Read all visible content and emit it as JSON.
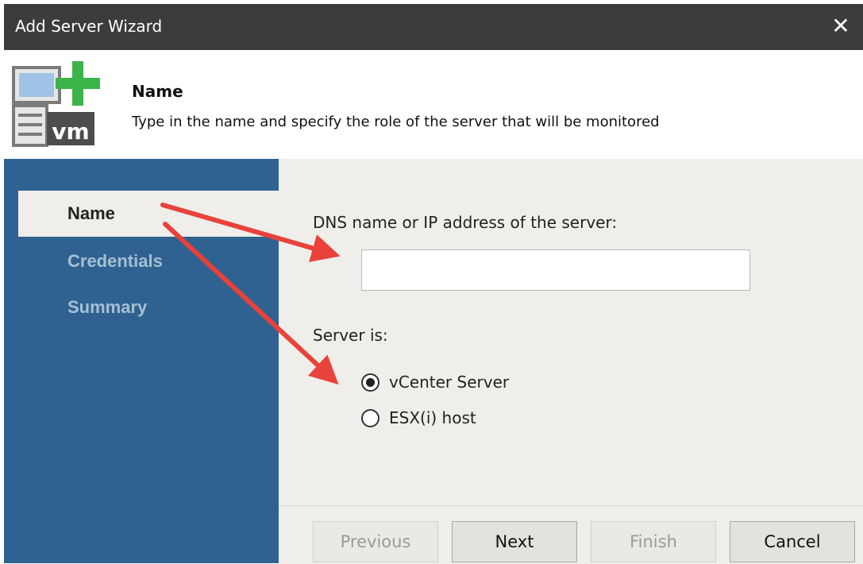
{
  "window": {
    "title": "Add Server Wizard",
    "close_glyph": "✕",
    "close_icon": "close-icon"
  },
  "header": {
    "title": "Name",
    "subtitle": "Type in the name and specify the role of the server that will be monitored",
    "icon": "add-vm-server-icon",
    "icon_text": "vm"
  },
  "sidebar": {
    "items": [
      {
        "label": "Name",
        "active": true
      },
      {
        "label": "Credentials",
        "active": false
      },
      {
        "label": "Summary",
        "active": false
      }
    ]
  },
  "form": {
    "dns_label": "DNS name or IP address of the server:",
    "dns_value": "",
    "dns_placeholder": "",
    "server_is_label": "Server is:",
    "options": [
      {
        "label": "vCenter Server",
        "selected": true
      },
      {
        "label": "ESX(i) host",
        "selected": false
      }
    ]
  },
  "buttons": {
    "previous": "Previous",
    "next": "Next",
    "finish": "Finish",
    "cancel": "Cancel"
  },
  "colors": {
    "sidebar_bg": "#2f6290",
    "title_bar": "#3c3c3c",
    "annotation_arrow": "#e8423a",
    "accent_green": "#3cb44a"
  }
}
